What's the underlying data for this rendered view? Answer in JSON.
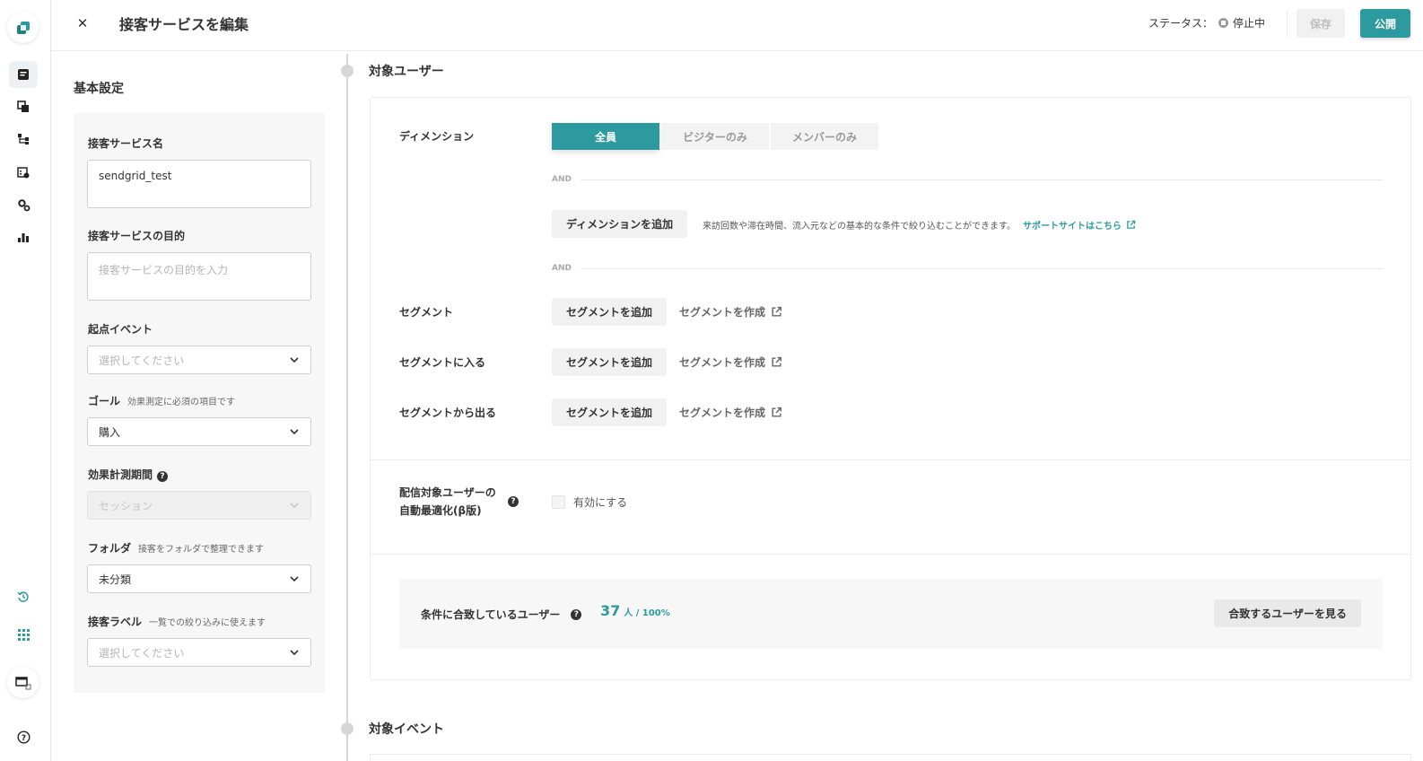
{
  "header": {
    "title": "接客サービスを編集",
    "close_label": "✕",
    "status_label": "ステータス：",
    "status_value": "停止中",
    "save_label": "保存",
    "publish_label": "公開"
  },
  "rail": {
    "items": [
      "logo-icon",
      "campaign-icon",
      "copy-icon",
      "flow-icon",
      "calendar-settings-icon",
      "gear-icon",
      "chart-icon",
      "history-icon",
      "apps-grid-icon",
      "window-icon",
      "help-icon"
    ]
  },
  "basic": {
    "title": "基本設定",
    "name_label": "接客サービス名",
    "name_value": "sendgrid_test",
    "purpose_label": "接客サービスの目的",
    "purpose_placeholder": "接客サービスの目的を入力",
    "start_event_label": "起点イベント",
    "start_event_value": "選択してください",
    "goal_label": "ゴール",
    "goal_note": "効果測定に必須の項目です",
    "goal_value": "購入",
    "period_label": "効果計測期間",
    "period_value": "セッション",
    "folder_label": "フォルダ",
    "folder_note": "接客をフォルダで整理できます",
    "folder_value": "未分類",
    "tag_label": "接客ラベル",
    "tag_note": "一覧での絞り込みに使えます",
    "tag_value": "選択してください"
  },
  "target_users": {
    "title": "対象ユーザー",
    "dimension_label": "ディメンション",
    "tabs": [
      "全員",
      "ビジターのみ",
      "メンバーのみ"
    ],
    "and_label": "AND",
    "add_dimension": "ディメンションを追加",
    "dimension_help": "来訪回数や滞在時間、流入元などの基本的な条件で絞り込むことができます。",
    "support_link": "サポートサイトはこちら",
    "segment_rows": [
      {
        "label": "セグメント",
        "add": "セグメントを追加",
        "create": "セグメントを作成"
      },
      {
        "label": "セグメントに入る",
        "add": "セグメントを追加",
        "create": "セグメントを作成"
      },
      {
        "label": "セグメントから出る",
        "add": "セグメントを追加",
        "create": "セグメントを作成"
      }
    ],
    "optimize_label_line1": "配信対象ユーザーの",
    "optimize_label_line2": "自動最適化(β版)",
    "optimize_checkbox": "有効にする",
    "match_label": "条件に合致しているユーザー",
    "match_count": "37",
    "match_unit": "人 / 100%",
    "match_button": "合致するユーザーを見る"
  },
  "target_events": {
    "title": "対象イベント"
  },
  "colors": {
    "accent": "#2c9a9e",
    "status_dot": "#9a9a9a"
  }
}
